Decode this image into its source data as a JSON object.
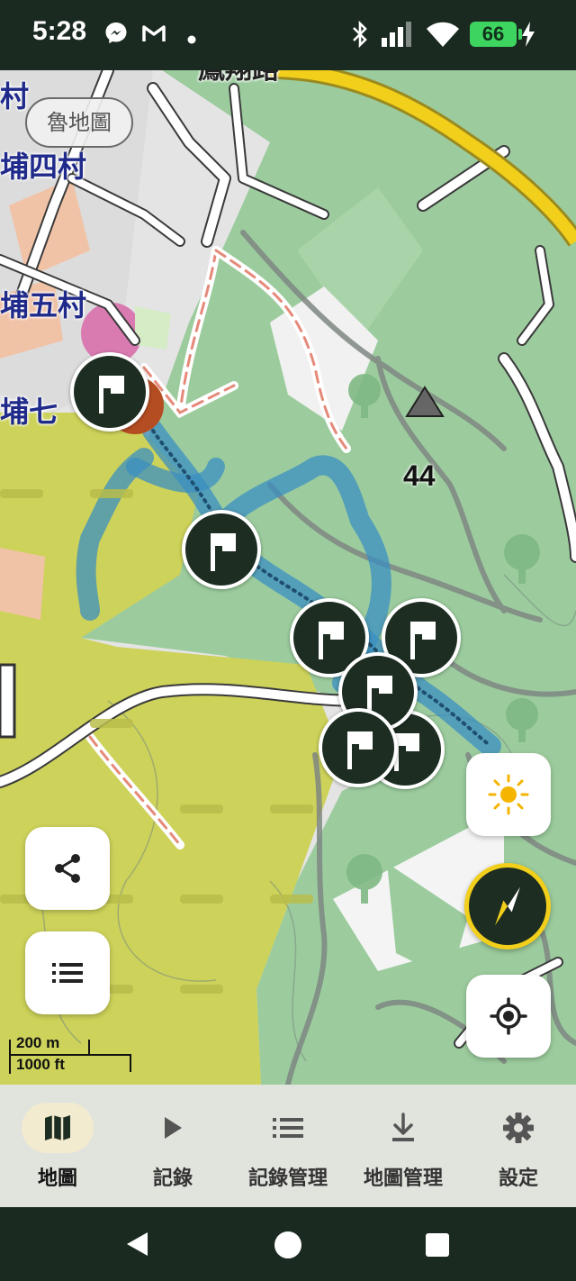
{
  "status_bar": {
    "time": "5:28",
    "battery": "66",
    "icons": [
      "messenger-icon",
      "gmail-icon",
      "dot-icon",
      "bluetooth-icon",
      "signal-icon",
      "wifi-icon",
      "charging-icon"
    ]
  },
  "map": {
    "source_chip": "魯地圖",
    "labels": {
      "village_top": "村",
      "village_4": "埔四村",
      "village_5": "埔五村",
      "village_7": "埔七",
      "road_top": "鳳翔路"
    },
    "peak_height": "44",
    "scale": {
      "metric": "200 m",
      "imperial": "1000 ft"
    },
    "colors": {
      "forest": "#9ccc9e",
      "military": "#cdd25a",
      "route": "#3b8fc2",
      "main_road": "#f2cf1a",
      "marker": "#1d2d22"
    }
  },
  "map_buttons": {
    "share": "share-icon",
    "list": "list-icon",
    "brightness": "sun-icon",
    "compass": "compass-icon",
    "locate": "locate-icon"
  },
  "bottom_nav": {
    "items": [
      {
        "label": "地圖",
        "icon": "map-icon",
        "active": true
      },
      {
        "label": "記錄",
        "icon": "play-icon",
        "active": false
      },
      {
        "label": "記錄管理",
        "icon": "list-icon",
        "active": false
      },
      {
        "label": "地圖管理",
        "icon": "download-icon",
        "active": false
      },
      {
        "label": "設定",
        "icon": "gear-icon",
        "active": false
      }
    ]
  },
  "system_nav": [
    "back-icon",
    "home-icon",
    "recents-icon"
  ]
}
